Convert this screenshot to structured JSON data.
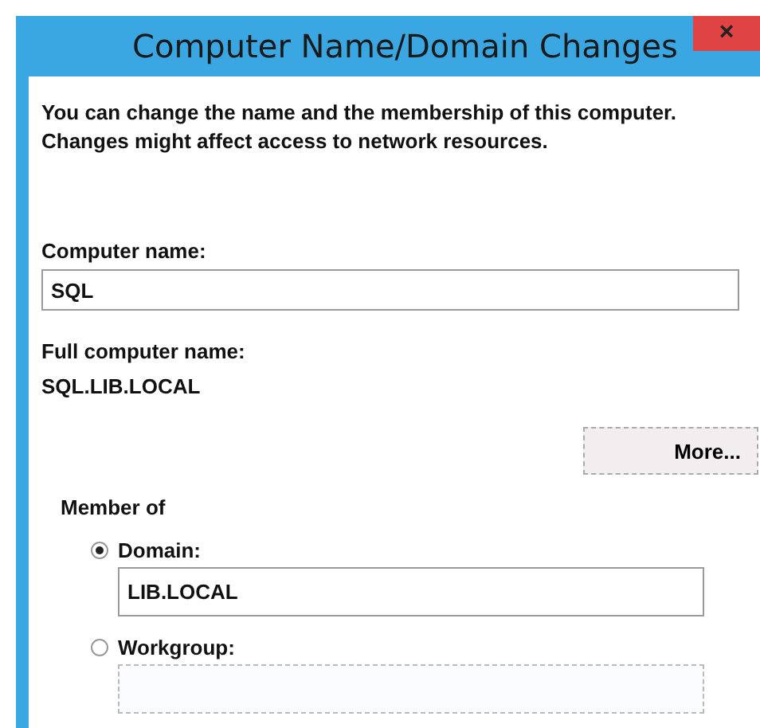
{
  "window": {
    "title": "Computer Name/Domain Changes",
    "close": "×"
  },
  "intro": "You can change the name and the membership of this computer. Changes might affect access to network resources.",
  "computer_name": {
    "label": "Computer name:",
    "value": "SQL"
  },
  "full_name": {
    "label": "Full computer name:",
    "value": "SQL.LIB.LOCAL"
  },
  "more_button": "More...",
  "member_of": {
    "label": "Member of",
    "options": [
      {
        "label": "Domain:",
        "selected": true,
        "value": "LIB.LOCAL"
      },
      {
        "label": "Workgroup:",
        "selected": false
      }
    ]
  }
}
